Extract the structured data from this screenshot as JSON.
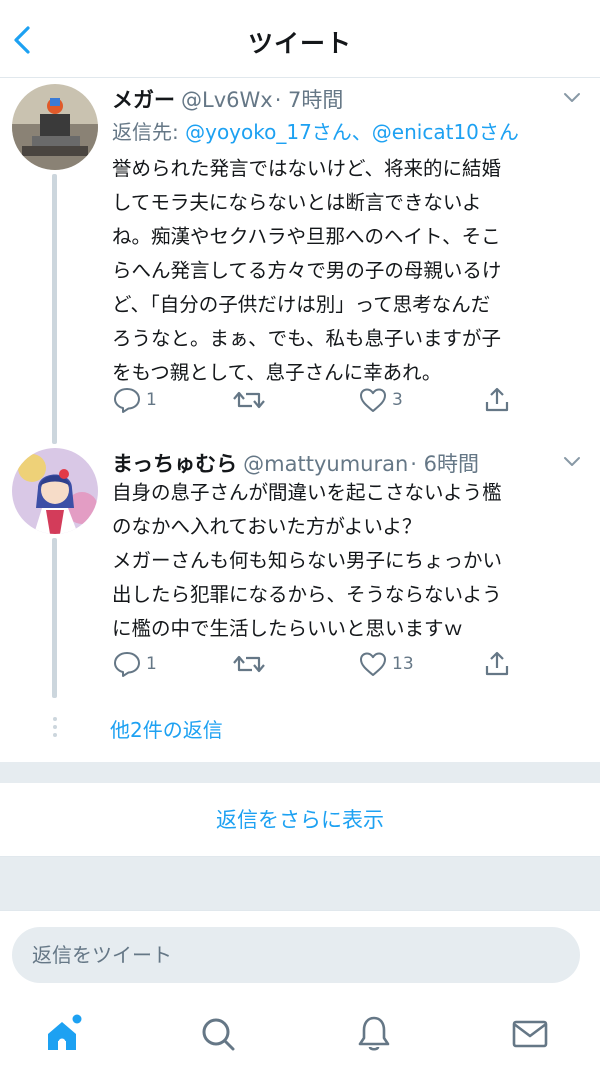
{
  "header": {
    "title": "ツイート"
  },
  "tweets": [
    {
      "name": "メガー",
      "handle": "@Lv6Wx",
      "time": "· 7時間",
      "reply_to_label": "返信先:",
      "reply_to_users": "@yoyoko_17さん、@enicat10さん",
      "lines": [
        "誉められた発言ではないけど、将来的に結婚",
        "してモラ夫にならないとは断言できないよ",
        "ね。痴漢やセクハラや旦那へのヘイト、そこ",
        "らへん発言してる方々で男の子の母親いるけ",
        "ど、「自分の子供だけは別」って思考なんだ",
        "ろうなと。まぁ、でも、私も息子いますが子",
        "をもつ親として、息子さんに幸あれ。"
      ],
      "replies": "1",
      "retweets": "",
      "likes": "3"
    },
    {
      "name": "まっちゅむら",
      "handle": "@mattyumuran",
      "time": "· 6時間",
      "lines": [
        "自身の息子さんが間違いを起こさないよう檻",
        "のなかへ入れておいた方がよいよ？",
        "メガーさんも何も知らない男子にちょっかい",
        "出したら犯罪になるから、そうならないよう",
        "に檻の中で生活したらいいと思いますｗ"
      ],
      "replies": "1",
      "retweets": "",
      "likes": "13"
    }
  ],
  "more_replies": "他2件の返信",
  "show_more_replies": "返信をさらに表示",
  "composer": {
    "placeholder": "返信をツイート"
  },
  "icons": {
    "back": "chevron-left-icon",
    "caret": "chevron-down-icon",
    "reply": "reply-icon",
    "retweet": "retweet-icon",
    "like": "heart-icon",
    "share": "share-icon",
    "home": "home-icon",
    "search": "search-icon",
    "notifications": "bell-icon",
    "messages": "mail-icon"
  },
  "colors": {
    "accent": "#1da1f2",
    "secondary_text": "#657786",
    "band": "#e6ecf0"
  }
}
